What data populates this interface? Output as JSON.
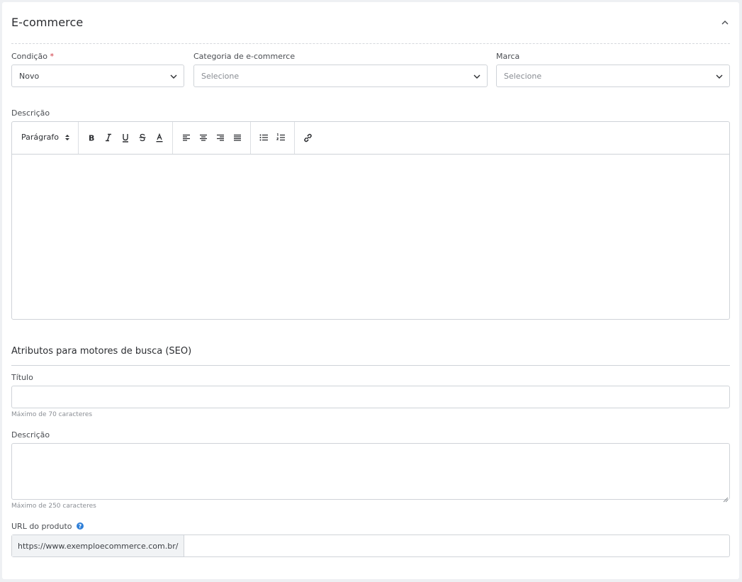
{
  "section": {
    "title": "E-commerce"
  },
  "fields": {
    "condicao": {
      "label": "Condição",
      "required_mark": "*",
      "value": "Novo"
    },
    "categoria": {
      "label": "Categoria de e-commerce",
      "placeholder": "Selecione"
    },
    "marca": {
      "label": "Marca",
      "placeholder": "Selecione"
    },
    "descricao": {
      "label": "Descrição",
      "paragraph_style": "Parágrafo"
    }
  },
  "seo": {
    "title": "Atributos para motores de busca (SEO)",
    "titulo": {
      "label": "Título",
      "hint": "Máximo de 70 caracteres",
      "value": ""
    },
    "descricao": {
      "label": "Descrição",
      "hint": "Máximo de 250 caracteres",
      "value": ""
    },
    "url": {
      "label": "URL do produto",
      "prefix": "https://www.exemploecommerce.com.br/",
      "value": ""
    }
  },
  "colors": {
    "required": "#d0353f",
    "help": "#2f7fd8",
    "border": "#cfd3d8"
  },
  "icons": [
    "chevron-up-icon",
    "chevron-down-icon",
    "sort-arrows-icon",
    "bold-icon",
    "italic-icon",
    "underline-icon",
    "strikethrough-icon",
    "text-color-icon",
    "align-left-icon",
    "align-center-icon",
    "align-right-icon",
    "align-justify-icon",
    "bullet-list-icon",
    "numbered-list-icon",
    "link-icon",
    "help-icon"
  ]
}
